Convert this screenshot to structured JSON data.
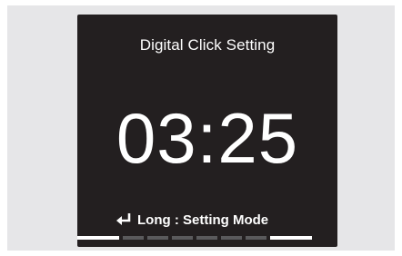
{
  "screen": {
    "title": "Digital Click Setting",
    "time": "03:25",
    "hint_icon": "enter-icon",
    "hint_text": "Long : Setting Mode"
  },
  "progress": {
    "segments": [
      {
        "state": "active"
      },
      {
        "state": "inactive"
      },
      {
        "state": "inactive"
      },
      {
        "state": "inactive"
      },
      {
        "state": "inactive"
      },
      {
        "state": "inactive"
      },
      {
        "state": "inactive"
      },
      {
        "state": "active"
      }
    ],
    "colors": {
      "active": "#ffffff",
      "inactive": "#5a5a5c"
    }
  },
  "colors": {
    "screen_background": "#231f20",
    "page_background": "#e6e6e8",
    "text": "#ffffff"
  }
}
